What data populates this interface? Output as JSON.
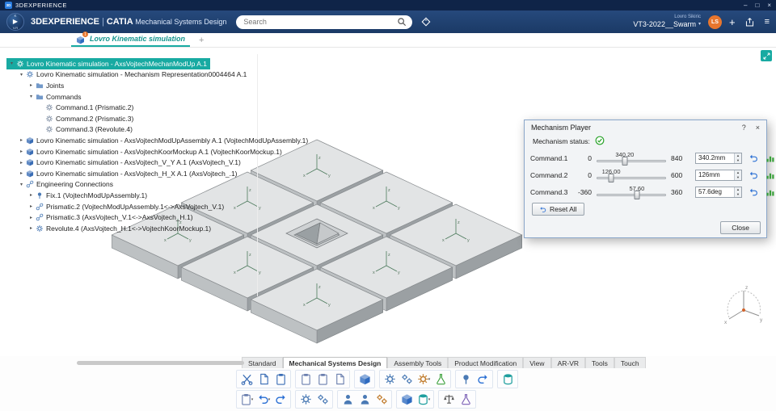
{
  "titlebar": {
    "app_name": "3DEXPERIENCE",
    "logo": "3D",
    "minimize": "–",
    "maximize": "□",
    "close": "×"
  },
  "header": {
    "brand": "3DEXPERIENCE",
    "pipe": "|",
    "app": "CATIA",
    "suite": "Mechanical Systems Design",
    "search_placeholder": "Search",
    "user_name": "Lovro Sikiric",
    "workspace": "VT3-2022__Swarm",
    "workspace_caret": "▾",
    "avatar_initials": "LS",
    "plus": "+",
    "menu": "≡",
    "logo_top": "K",
    "logo_play": "▶",
    "logo_bottom": "V.R"
  },
  "tabbar": {
    "active_tab": "Lovro Kinematic simulation",
    "badge": "1",
    "new_tab": "+"
  },
  "tree": {
    "glyphs": {
      "open": "▾",
      "closed": "▸",
      "leaf": ""
    },
    "items": [
      "Lovro Kinematic simulation - AxsVojtechMechanModUp A.1",
      "Lovro Kinematic simulation - Mechanism Representation0004464 A.1",
      "Joints",
      "Commands",
      "Command.1 (Prismatic.2)",
      "Command.2 (Prismatic.3)",
      "Command.3 (Revolute.4)",
      "Lovro Kinematic simulation - AxsVojtechModUpAssembly A.1 (VojtechModUpAssembly.1)",
      "Lovro Kinematic simulation - AxsVojtechKoorMockup A.1 (VojtechKoorMockup.1)",
      "Lovro Kinematic simulation - AxsVojtech_V_Y A.1 (AxsVojtech_V.1)",
      "Lovro Kinematic simulation - AxsVojtech_H_X A.1 (AxsVojtech_.1)",
      "Engineering Connections",
      "Fix.1 (VojtechModUpAssembly.1)",
      "Prismatic.2 (VojtechModUpAssembly.1<->AxsVojtech_V.1)",
      "Prismatic.3 (AxsVojtech_V.1<->AxsVojtech_H.1)",
      "Revolute.4 (AxsVojtech_H.1<->VojtechKoorMockup.1)"
    ]
  },
  "dialog": {
    "title": "Mechanism Player",
    "help": "?",
    "close_x": "×",
    "status_label": "Mechanism status:",
    "spin_up": "▲",
    "spin_down": "▼",
    "rows": [
      {
        "name": "Command.1",
        "min": "0",
        "value": "340.20",
        "max": "840",
        "field": "340.2mm",
        "pct": 40.5
      },
      {
        "name": "Command.2",
        "min": "0",
        "value": "126.00",
        "max": "600",
        "field": "126mm",
        "pct": 21
      },
      {
        "name": "Command.3",
        "min": "-360",
        "value": "57.60",
        "max": "360",
        "field": "57.6deg",
        "pct": 58
      }
    ],
    "reset_all": "Reset All",
    "close": "Close"
  },
  "ribbon": {
    "tabs": [
      "Standard",
      "Mechanical Systems Design",
      "Assembly Tools",
      "Product Modification",
      "View",
      "AR-VR",
      "Tools",
      "Touch"
    ],
    "active_tab": "Mechanical Systems Design"
  },
  "toolbar": {
    "caret": "▾",
    "row1": [
      "cut",
      "copy",
      "paste",
      "paste-special",
      "paste-with-link",
      "duplicate",
      "new-product",
      "create-joint",
      "mechanism-manager",
      "speed-acceleration",
      "mechanism-check",
      "fix-part",
      "update",
      "save-session"
    ],
    "row2": [
      "paste-options",
      "undo",
      "redo",
      "options",
      "tools",
      "share",
      "collaborate",
      "generate",
      "insert-component",
      "store-data",
      "measure-inertia",
      "analysis"
    ]
  },
  "compass": {
    "x": "x",
    "y": "y",
    "z": "z"
  },
  "colors": {
    "accent": "#18aaa2",
    "header": "#1d3e6d",
    "status_green": "#2ea52e",
    "avatar": "#e8762d"
  }
}
